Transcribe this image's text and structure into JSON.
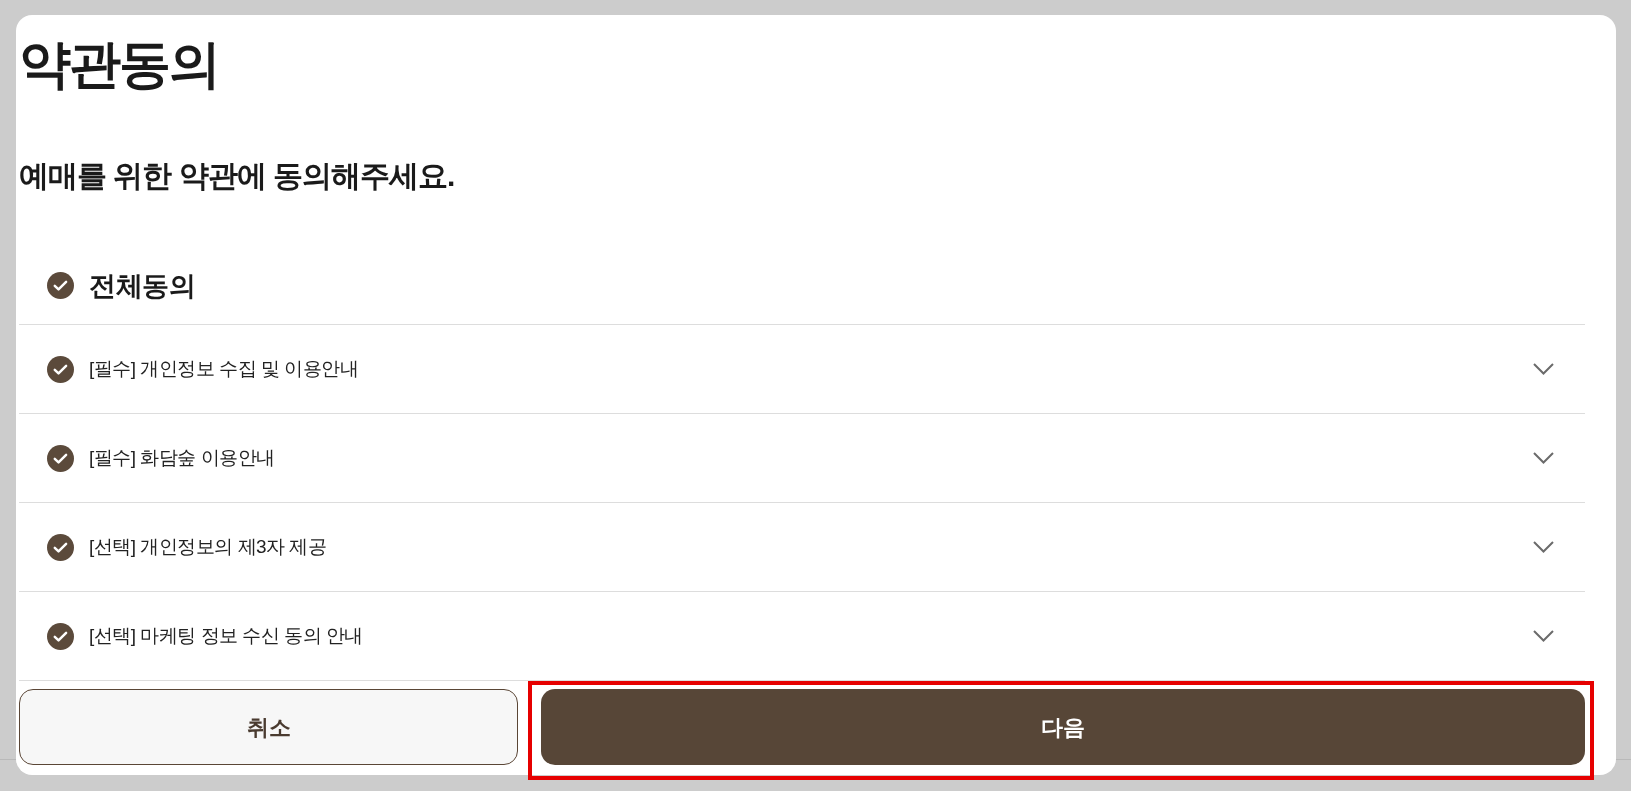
{
  "title": "약관동의",
  "subtitle": "예매를 위한 약관에 동의해주세요.",
  "agree_all": {
    "label": "전체동의",
    "checked": true
  },
  "terms": [
    {
      "label": "[필수] 개인정보 수집 및 이용안내",
      "checked": true,
      "expanded": false
    },
    {
      "label": "[필수] 화담숲 이용안내",
      "checked": true,
      "expanded": false
    },
    {
      "label": "[선택] 개인정보의 제3자 제공",
      "checked": true,
      "expanded": false
    },
    {
      "label": "[선택] 마케팅 정보 수신 동의 안내",
      "checked": true,
      "expanded": false
    }
  ],
  "buttons": [
    {
      "label": "취소",
      "kind": "secondary",
      "highlighted": false
    },
    {
      "label": "다음",
      "kind": "primary",
      "highlighted": true
    }
  ]
}
